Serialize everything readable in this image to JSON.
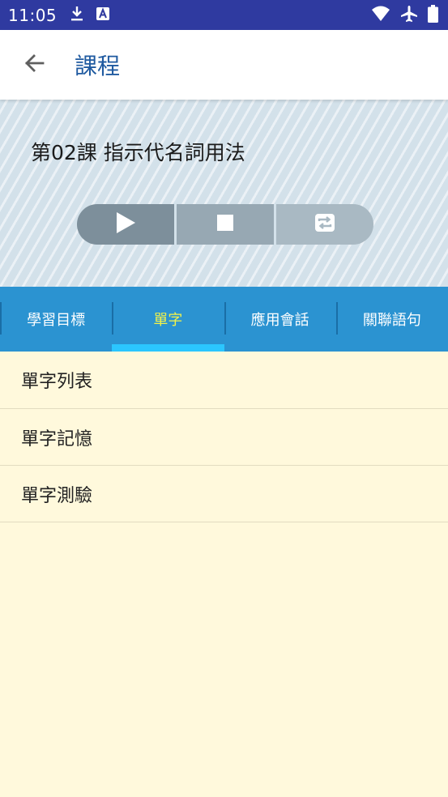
{
  "status_bar": {
    "time": "11:05",
    "icons": [
      "download-icon",
      "accessibility-icon",
      "wifi-icon",
      "airplane-icon",
      "battery-icon"
    ]
  },
  "app_bar": {
    "title": "課程",
    "back_icon": "arrow-back-icon"
  },
  "lesson": {
    "title": "第02課 指示代名詞用法"
  },
  "player": {
    "buttons": [
      "play-icon",
      "stop-icon",
      "repeat-icon"
    ]
  },
  "tabs": [
    {
      "label": "學習目標",
      "active": false
    },
    {
      "label": "單字",
      "active": true
    },
    {
      "label": "應用會話",
      "active": false
    },
    {
      "label": "關聯語句",
      "active": false
    }
  ],
  "list": {
    "items": [
      "單字列表",
      "單字記憶",
      "單字測驗"
    ]
  },
  "colors": {
    "status_bar": "#2f3aa0",
    "title_blue": "#1f5aa0",
    "tab_bar": "#2b93d1",
    "tab_active_text": "#f2f24a",
    "tab_indicator": "#2bc6ff",
    "content_bg": "#fff9dc"
  }
}
